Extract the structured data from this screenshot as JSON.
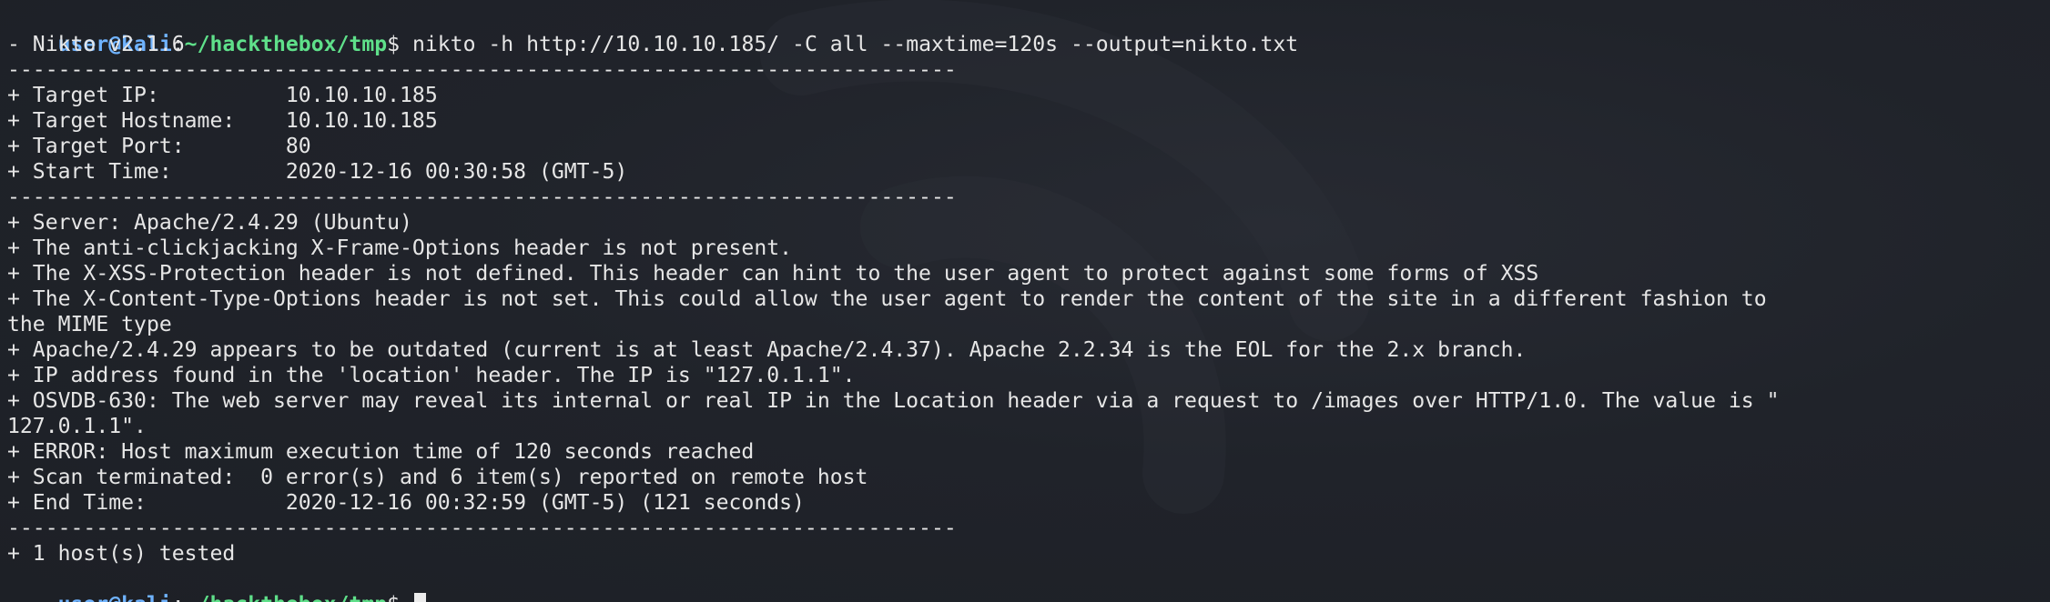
{
  "prompt": {
    "user_host": "user@kali",
    "colon": ":",
    "path": "~/hackthebox/tmp",
    "dollar": "$ "
  },
  "command": "nikto -h http://10.10.10.185/ -C all --maxtime=120s --output=nikto.txt",
  "output_lines": [
    "- Nikto v2.1.6",
    "---------------------------------------------------------------------------",
    "+ Target IP:          10.10.10.185",
    "+ Target Hostname:    10.10.10.185",
    "+ Target Port:        80",
    "+ Start Time:         2020-12-16 00:30:58 (GMT-5)",
    "---------------------------------------------------------------------------",
    "+ Server: Apache/2.4.29 (Ubuntu)",
    "+ The anti-clickjacking X-Frame-Options header is not present.",
    "+ The X-XSS-Protection header is not defined. This header can hint to the user agent to protect against some forms of XSS",
    "+ The X-Content-Type-Options header is not set. This could allow the user agent to render the content of the site in a different fashion to",
    "the MIME type",
    "+ Apache/2.4.29 appears to be outdated (current is at least Apache/2.4.37). Apache 2.2.34 is the EOL for the 2.x branch.",
    "+ IP address found in the 'location' header. The IP is \"127.0.1.1\".",
    "+ OSVDB-630: The web server may reveal its internal or real IP in the Location header via a request to /images over HTTP/1.0. The value is \"",
    "127.0.1.1\".",
    "+ ERROR: Host maximum execution time of 120 seconds reached",
    "+ Scan terminated:  0 error(s) and 6 item(s) reported on remote host",
    "+ End Time:           2020-12-16 00:32:59 (GMT-5) (121 seconds)",
    "---------------------------------------------------------------------------",
    "+ 1 host(s) tested"
  ]
}
